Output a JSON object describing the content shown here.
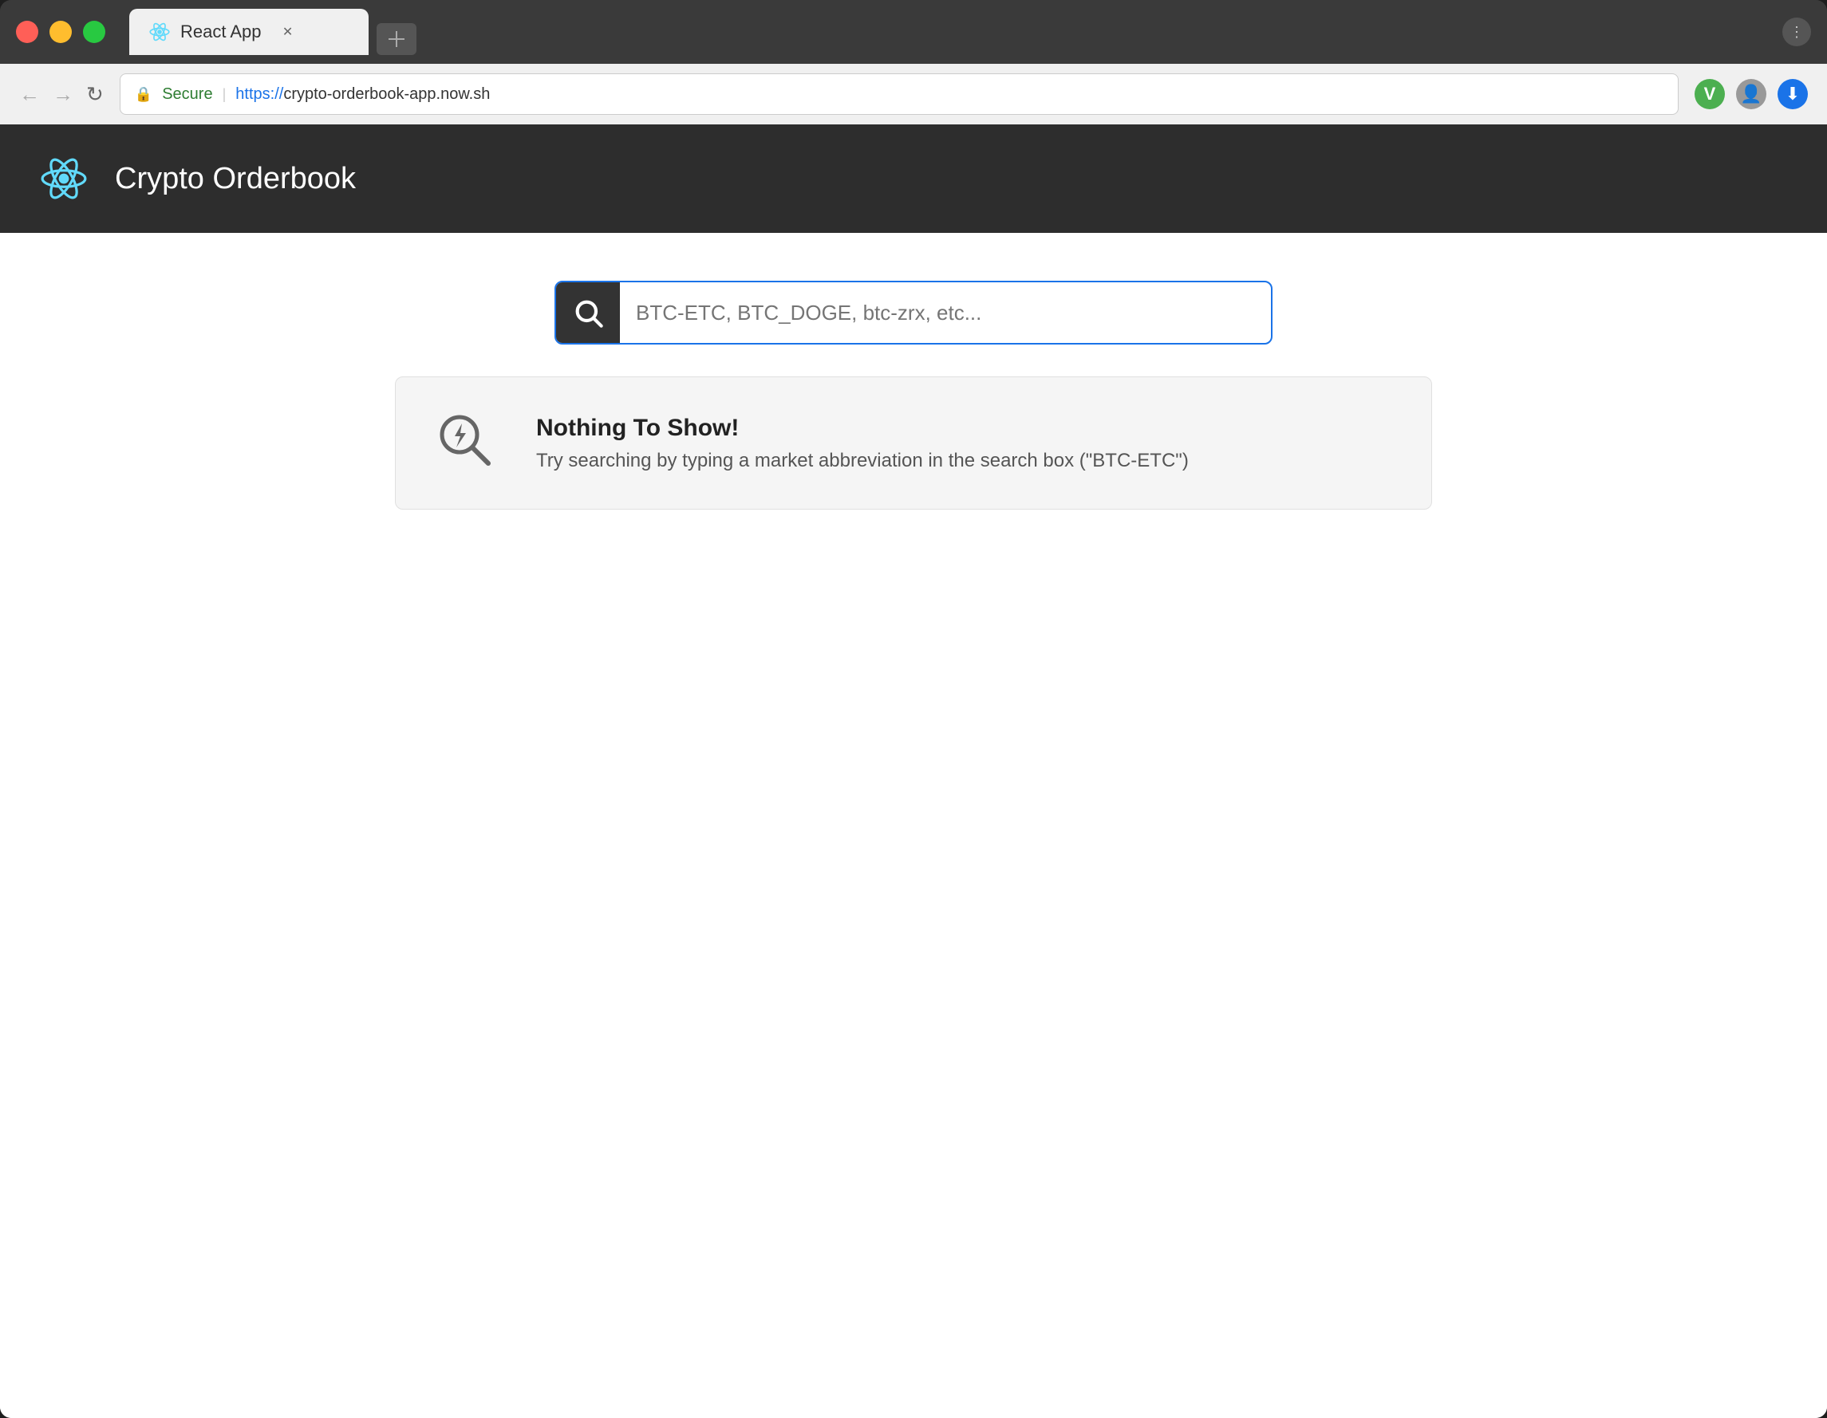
{
  "browser": {
    "tab_title": "React App",
    "url_secure_label": "Secure",
    "url": "https://crypto-orderbook-app.now.sh",
    "url_protocol": "https://",
    "url_domain": "crypto-orderbook-app.now.sh"
  },
  "app": {
    "title": "Crypto Orderbook",
    "search": {
      "placeholder": "BTC-ETC, BTC_DOGE, btc-zrx, etc..."
    },
    "empty_state": {
      "title": "Nothing To Show!",
      "subtitle": "Try searching by typing a market abbreviation in the search box (\"BTC-ETC\")"
    }
  }
}
